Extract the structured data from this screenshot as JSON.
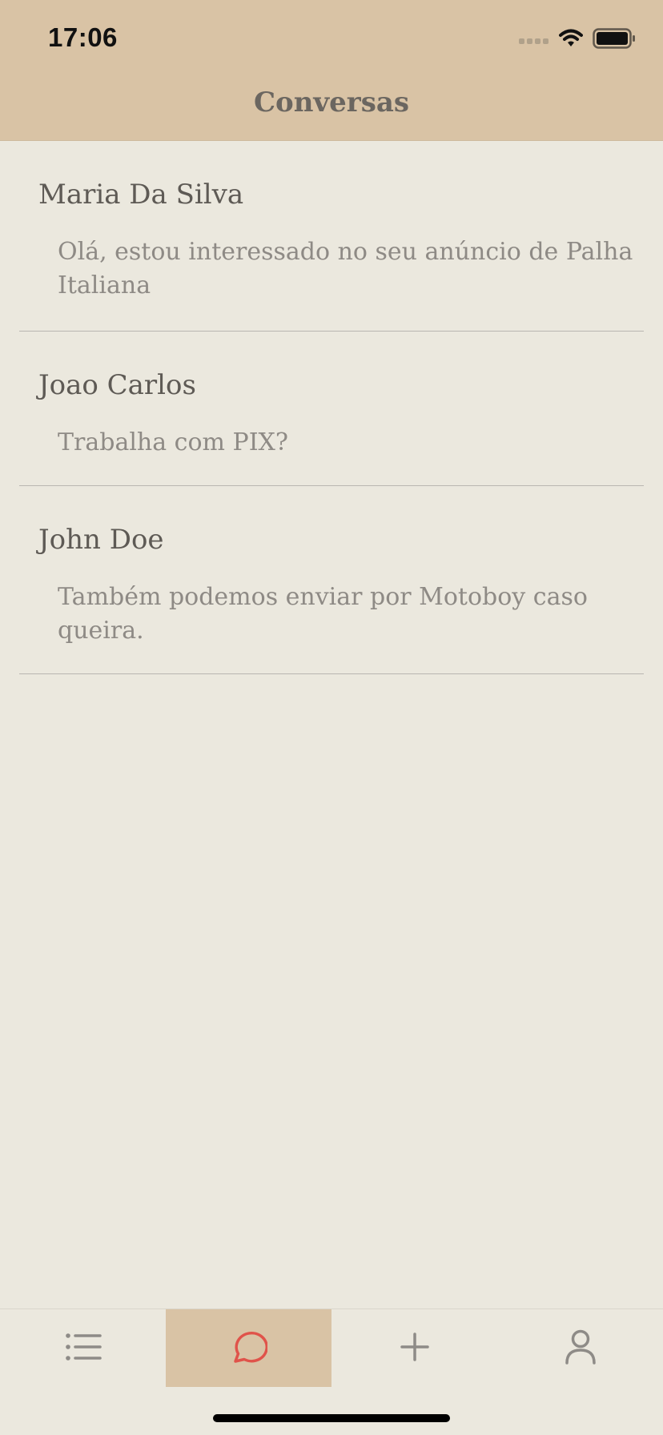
{
  "status_bar": {
    "time": "17:06"
  },
  "nav": {
    "title": "Conversas"
  },
  "conversations": [
    {
      "name": "Maria Da Silva",
      "preview": "Olá, estou interessado no seu anúncio de Palha Italiana"
    },
    {
      "name": "Joao Carlos",
      "preview": "Trabalha com PIX?"
    },
    {
      "name": "John Doe",
      "preview": "Também podemos enviar por Motoboy caso queira."
    }
  ],
  "tab_bar": {
    "tabs": [
      {
        "icon": "list-icon",
        "active": false
      },
      {
        "icon": "chat-bubble-icon",
        "active": true
      },
      {
        "icon": "plus-icon",
        "active": false
      },
      {
        "icon": "person-icon",
        "active": false
      }
    ]
  },
  "colors": {
    "header_bg": "#D9C3A5",
    "page_bg": "#EBE8DE",
    "active_icon": "#E0534A",
    "inactive_icon": "#8E8B87"
  }
}
